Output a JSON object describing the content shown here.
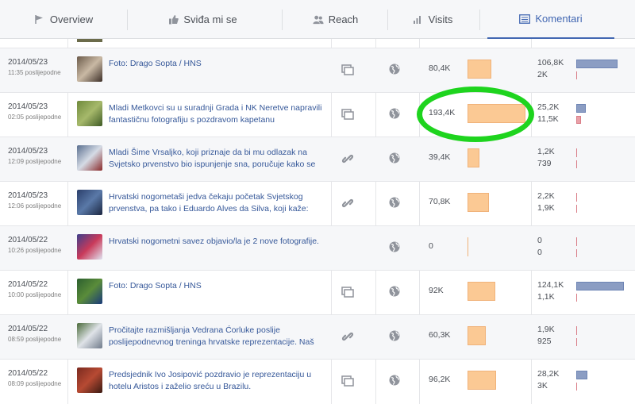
{
  "tabs": [
    {
      "label": "Overview",
      "icon": "flag-icon"
    },
    {
      "label": "Sviđa mi se",
      "icon": "like-icon"
    },
    {
      "label": "Reach",
      "icon": "people-icon"
    },
    {
      "label": "Visits",
      "icon": "bar-chart-icon"
    },
    {
      "label": "Komentari",
      "icon": "list-icon"
    }
  ],
  "active_tab": "Komentari",
  "colors": {
    "accent": "#4267b2",
    "reach_bar": "#fbc994",
    "engagement_bar": "#8b9dc3",
    "negative_bar": "#e9a0a8",
    "highlight": "#1ed41e"
  },
  "posts": [
    {
      "date": "2014/05/23",
      "time": "11:35 poslijepodne",
      "title": "Foto: Drago Sopta / HNS",
      "type": "photo",
      "reach": "80,4K",
      "reach_value": 80400,
      "eng1": "106,8K",
      "eng1_value": 106800,
      "eng2": "2K",
      "eng2_value": 2000
    },
    {
      "date": "2014/05/23",
      "time": "02:05 poslijepodne",
      "title": "Mladi Metkovci su u suradnji Grada i NK Neretve napravili fantastičnu fotografiju s pozdravom kapetanu reprezentacije",
      "type": "photo",
      "reach": "193,4K",
      "reach_value": 193400,
      "eng1": "25,2K",
      "eng1_value": 25200,
      "eng2": "11,5K",
      "eng2_value": 11500
    },
    {
      "date": "2014/05/23",
      "time": "12:09 poslijepodne",
      "title": "Mladi Šime Vrsaljko, koji priznaje da bi mu odlazak na Svjetsko prvenstvo bio ispunjenje sna, poručuje kako se",
      "type": "link",
      "reach": "39,4K",
      "reach_value": 39400,
      "eng1": "1,2K",
      "eng1_value": 1200,
      "eng2": "739",
      "eng2_value": 739
    },
    {
      "date": "2014/05/23",
      "time": "12:06 poslijepodne",
      "title": "Hrvatski nogometaši jedva čekaju početak Svjetskog prvenstva, pa tako i Eduardo Alves da Silva, koji kaže:",
      "type": "link",
      "reach": "70,8K",
      "reach_value": 70800,
      "eng1": "2,2K",
      "eng1_value": 2200,
      "eng2": "1,9K",
      "eng2_value": 1900
    },
    {
      "date": "2014/05/22",
      "time": "10:26 poslijepodne",
      "title": "Hrvatski nogometni savez objavio/la je 2 nove fotografije.",
      "type": "none",
      "reach": "0",
      "reach_value": 0,
      "eng1": "0",
      "eng1_value": 0,
      "eng2": "0",
      "eng2_value": 0
    },
    {
      "date": "2014/05/22",
      "time": "10:00 poslijepodne",
      "title": "Foto: Drago Sopta / HNS",
      "type": "photo",
      "reach": "92K",
      "reach_value": 92000,
      "eng1": "124,1K",
      "eng1_value": 124100,
      "eng2": "1,1K",
      "eng2_value": 1100
    },
    {
      "date": "2014/05/22",
      "time": "08:59 poslijepodne",
      "title": "Pročitajte razmišljanja Vedrana Ćorluke poslije poslijepodnevnog treninga hrvatske reprezentacije. Naš",
      "type": "link",
      "reach": "60,3K",
      "reach_value": 60300,
      "eng1": "1,9K",
      "eng1_value": 1900,
      "eng2": "925",
      "eng2_value": 925
    },
    {
      "date": "2014/05/22",
      "time": "08:09 poslijepodne",
      "title": "Predsjednik Ivo Josipović pozdravio je reprezentaciju u hotelu Aristos i zaželio sreću u Brazilu.",
      "type": "photo",
      "reach": "96,2K",
      "reach_value": 96200,
      "eng1": "28,2K",
      "eng1_value": 28200,
      "eng2": "3K",
      "eng2_value": 3000
    }
  ]
}
